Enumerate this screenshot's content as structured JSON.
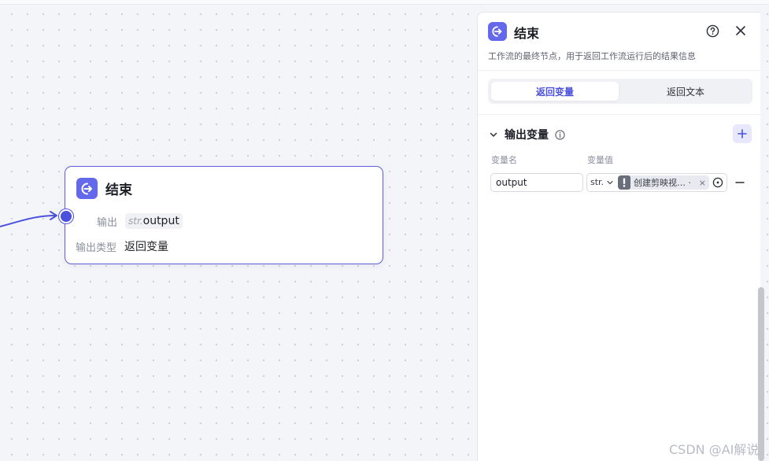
{
  "node": {
    "title": "结束",
    "output_label": "输出",
    "output_type_prefix": "str.",
    "output_var": "output",
    "output_kind_label": "输出类型",
    "output_kind_value": "返回变量"
  },
  "panel": {
    "title": "结束",
    "description": "工作流的最终节点，用于返回工作流运行后的结果信息",
    "tabs": [
      {
        "label": "返回变量",
        "active": true
      },
      {
        "label": "返回文本",
        "active": false
      }
    ],
    "section_title": "输出变量",
    "col_name_label": "变量名",
    "col_value_label": "变量值",
    "row": {
      "name_value": "output",
      "type_value": "str.",
      "reference_label": "创建剪映视… ·",
      "remove_label": "×"
    }
  },
  "colors": {
    "accent": "#4b51dd",
    "node_icon": "#6468ea"
  },
  "watermark": "CSDN @AI解说"
}
